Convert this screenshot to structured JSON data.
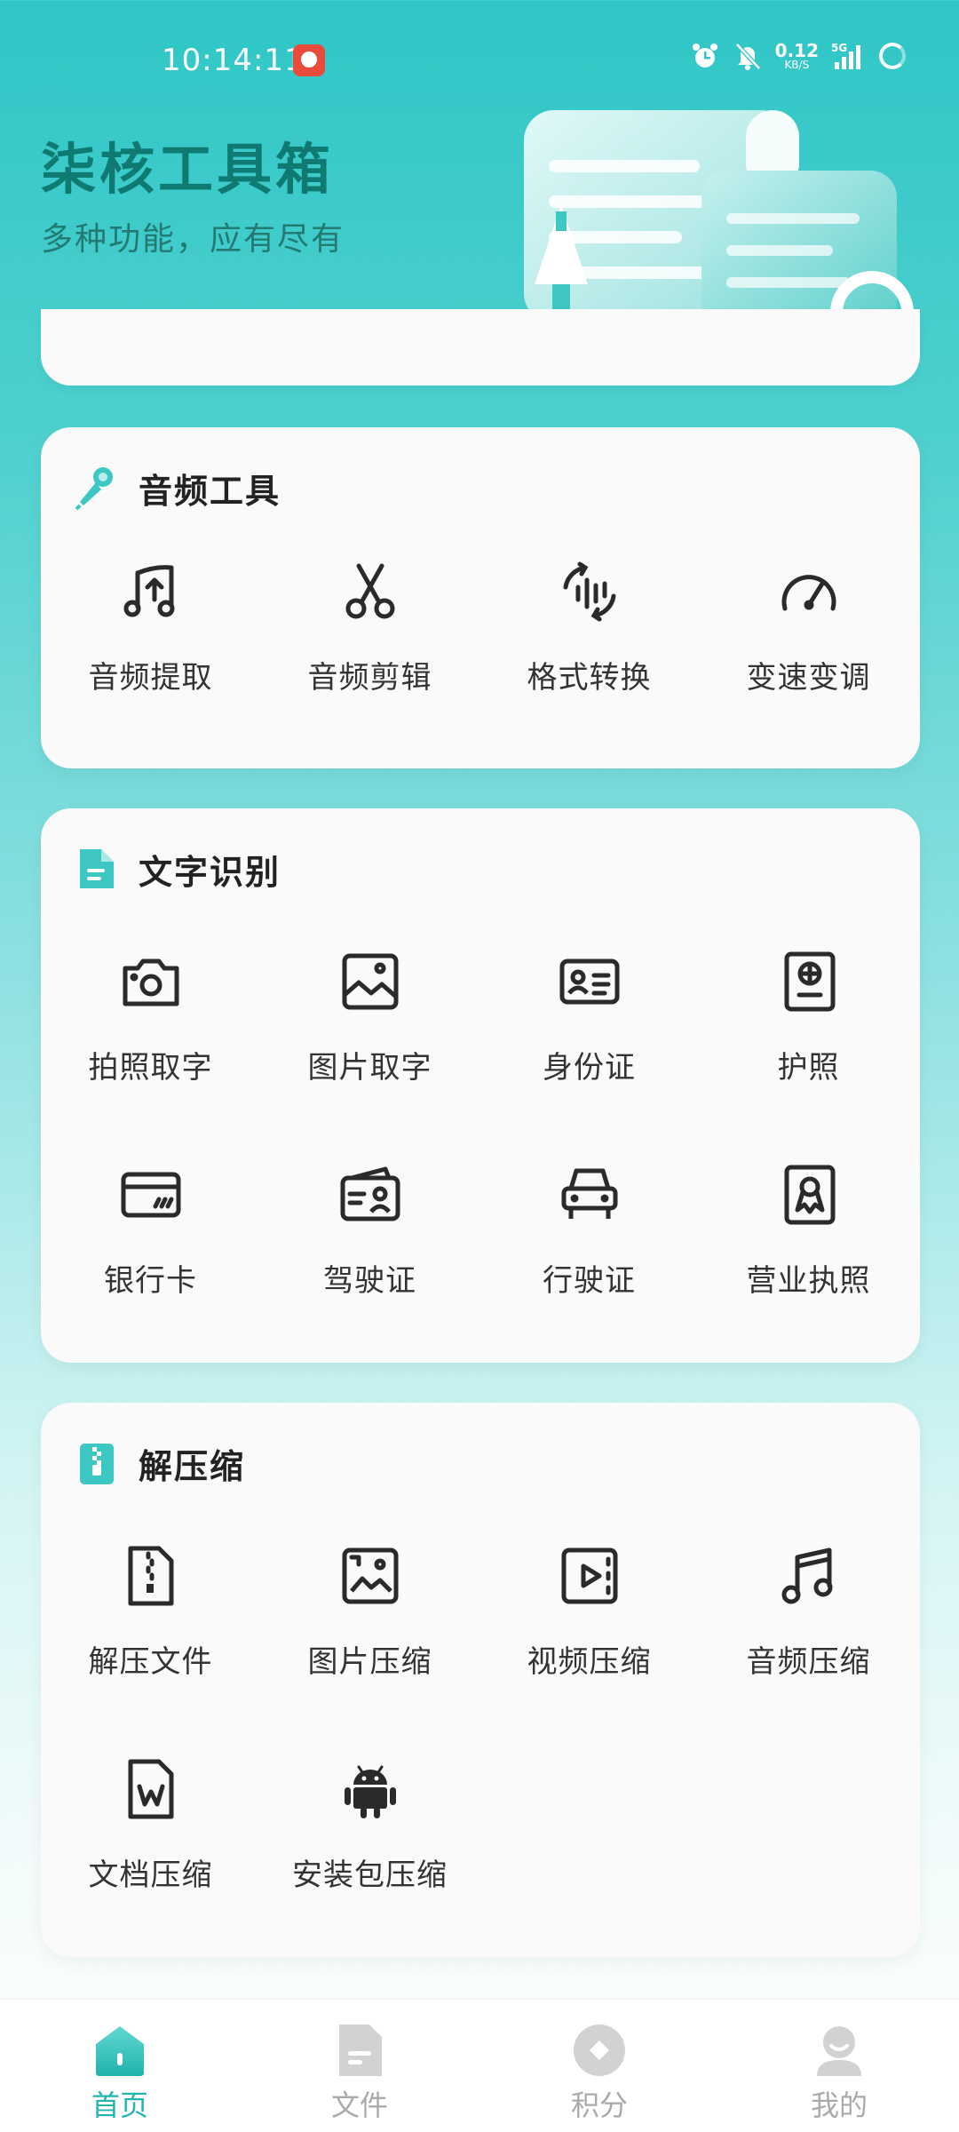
{
  "status_bar": {
    "time": "10:14:11",
    "net_speed_value": "0.12",
    "net_speed_unit": "KB/S",
    "network": "5G"
  },
  "header": {
    "title": "柒核工具箱",
    "subtitle": "多种功能，应有尽有"
  },
  "colors": {
    "accent": "#21b6b0",
    "title": "#0f7a72",
    "card_bg": "#fafafa",
    "inactive": "#aaaaaa"
  },
  "sections": {
    "audio": {
      "title": "音频工具",
      "icon": "microphone-icon",
      "items": [
        {
          "label": "音频提取",
          "icon": "music-extract-icon"
        },
        {
          "label": "音频剪辑",
          "icon": "scissors-icon"
        },
        {
          "label": "格式转换",
          "icon": "waveform-convert-icon"
        },
        {
          "label": "变速变调",
          "icon": "speedometer-icon"
        }
      ]
    },
    "ocr": {
      "title": "文字识别",
      "icon": "document-icon",
      "items": [
        {
          "label": "拍照取字",
          "icon": "camera-icon"
        },
        {
          "label": "图片取字",
          "icon": "image-icon"
        },
        {
          "label": "身份证",
          "icon": "id-card-icon"
        },
        {
          "label": "护照",
          "icon": "passport-icon"
        },
        {
          "label": "银行卡",
          "icon": "bank-card-icon"
        },
        {
          "label": "驾驶证",
          "icon": "driver-license-icon"
        },
        {
          "label": "行驶证",
          "icon": "car-icon"
        },
        {
          "label": "营业执照",
          "icon": "business-license-icon"
        }
      ]
    },
    "compress": {
      "title": "解压缩",
      "icon": "zip-icon",
      "items": [
        {
          "label": "解压文件",
          "icon": "zip-file-icon"
        },
        {
          "label": "图片压缩",
          "icon": "image-compress-icon"
        },
        {
          "label": "视频压缩",
          "icon": "video-icon"
        },
        {
          "label": "音频压缩",
          "icon": "music-note-icon"
        },
        {
          "label": "文档压缩",
          "icon": "word-doc-icon"
        },
        {
          "label": "安装包压缩",
          "icon": "android-icon"
        }
      ]
    }
  },
  "bottom_nav": [
    {
      "label": "首页",
      "icon": "home-icon",
      "active": true
    },
    {
      "label": "文件",
      "icon": "file-icon",
      "active": false
    },
    {
      "label": "积分",
      "icon": "points-icon",
      "active": false
    },
    {
      "label": "我的",
      "icon": "profile-icon",
      "active": false
    }
  ]
}
